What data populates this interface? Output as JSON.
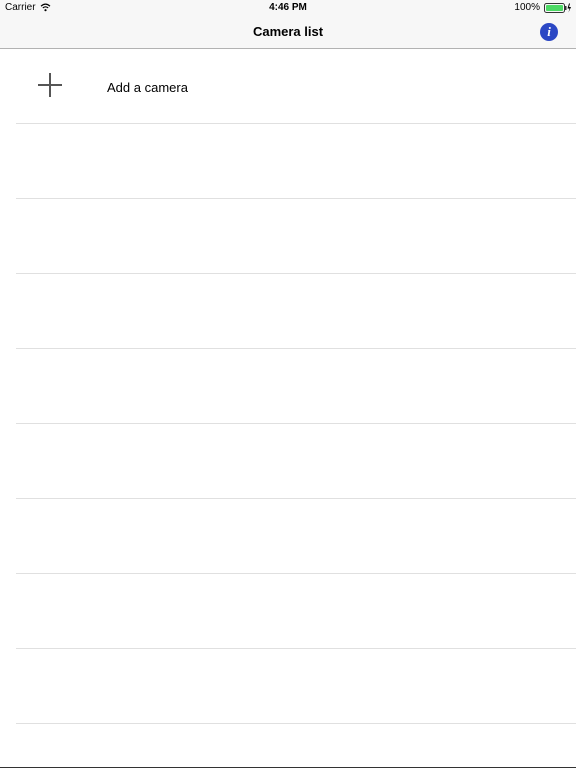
{
  "status_bar": {
    "carrier": "Carrier",
    "time": "4:46 PM",
    "battery_percent": "100%",
    "battery_level": 1.0,
    "icons": [
      "wifi-icon",
      "battery-icon",
      "charging-icon"
    ]
  },
  "nav": {
    "title": "Camera list",
    "info_icon": "info-icon",
    "info_glyph": "i",
    "accent_color": "#2b47c4"
  },
  "list": {
    "add_label": "Add a camera",
    "add_icon": "plus-icon",
    "empty_rows": 8
  }
}
